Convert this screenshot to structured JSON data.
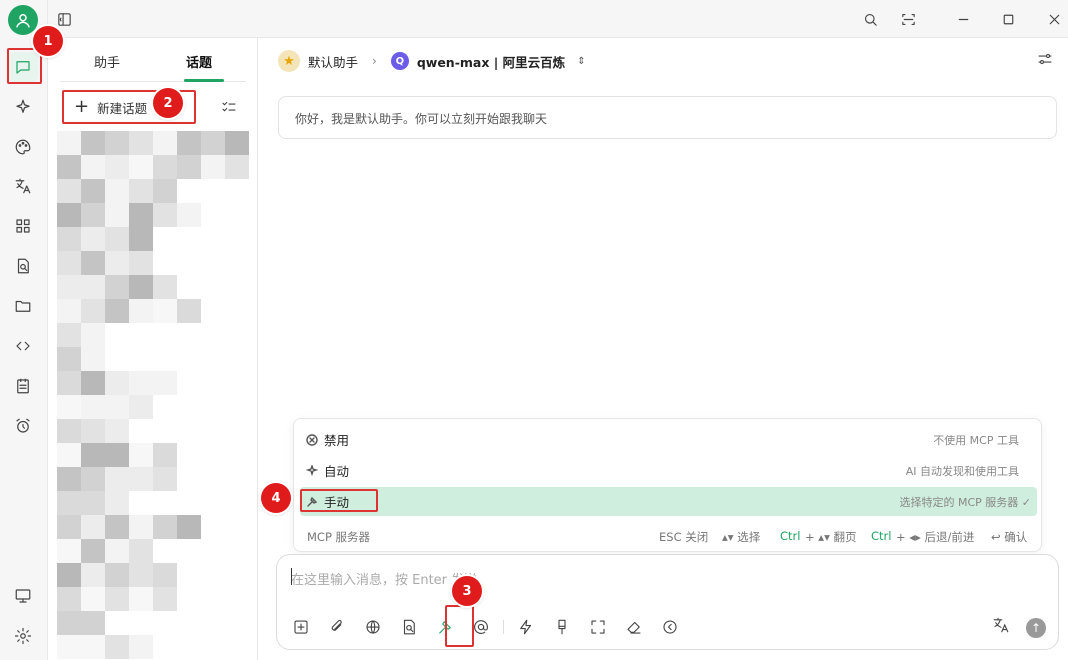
{
  "titlebar": {
    "icons": [
      "sidebar-toggle-icon",
      "search-icon",
      "scan-icon",
      "minimize-icon",
      "maximize-icon",
      "close-icon"
    ]
  },
  "rail": {
    "items": [
      "user-avatar",
      "chat-icon",
      "sparkle-icon",
      "palette-icon",
      "translate-icon",
      "apps-icon",
      "file-search-icon",
      "folder-icon",
      "code-icon",
      "notes-icon",
      "alarm-icon",
      "monitor-icon",
      "settings-icon"
    ]
  },
  "topics": {
    "tabs": [
      "助手",
      "话题"
    ],
    "active_tab": "话题",
    "new_topic_label": "新建话题"
  },
  "main": {
    "assistant_name": "默认助手",
    "model_name": "qwen-max | 阿里云百炼",
    "greeting": "你好，我是默认助手。你可以立刻开始跟我聊天"
  },
  "mcp_menu": {
    "items": [
      {
        "label": "禁用",
        "desc": "不使用 MCP 工具",
        "icon": "disabled-icon"
      },
      {
        "label": "自动",
        "desc": "AI 自动发现和使用工具",
        "icon": "sparkle-icon"
      },
      {
        "label": "手动",
        "desc": "选择特定的 MCP 服务器 ✓",
        "icon": "hammer-icon",
        "selected": true
      }
    ],
    "footer_label": "MCP 服务器",
    "hint_esc": "ESC 关闭",
    "hint_select": "▴▾ 选择",
    "hint_page_key": "Ctrl",
    "hint_page": "+ ▴▾ 翻页",
    "hint_nav_key": "Ctrl",
    "hint_nav": "+ ◂▸ 后退/前进",
    "hint_confirm": "↩ 确认"
  },
  "input": {
    "placeholder": "在这里输入消息，按 Enter 发送"
  },
  "badges": [
    "1",
    "2",
    "3",
    "4"
  ],
  "colors": {
    "accent": "#1fa464",
    "annotation": "#e01b1b",
    "selected_row": "#cfeedd"
  }
}
